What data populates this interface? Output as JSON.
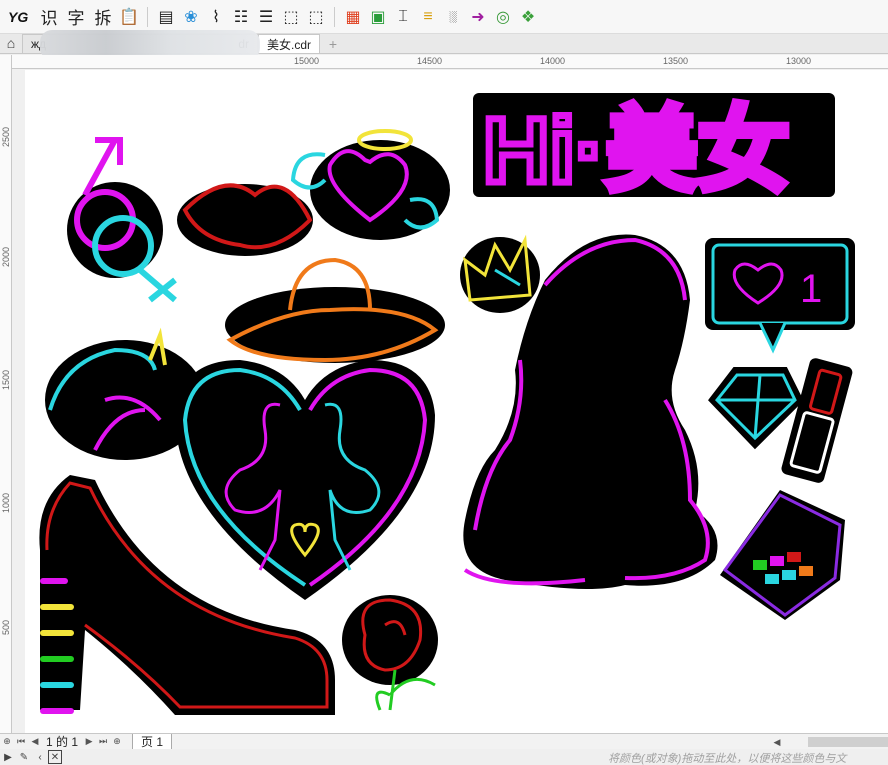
{
  "toolbar": {
    "logo": "YG",
    "zh_buttons": [
      "识",
      "字",
      "拆"
    ]
  },
  "tabs": {
    "first": "жд",
    "first_suffix": "dr",
    "active": "美女.cdr",
    "add": "+"
  },
  "ruler": {
    "top_labels": [
      "15000",
      "14500",
      "14000",
      "13500",
      "13000"
    ],
    "left_labels": [
      "2500",
      "2000",
      "1500",
      "1000",
      "500"
    ]
  },
  "artwork": {
    "headline": "Hi·美女",
    "like_count": "1"
  },
  "pagebar": {
    "page_status": "1 的 1",
    "page_tab": "页 1"
  },
  "status": {
    "hint": "将颜色(或对象)拖动至此处，以便将这些颜色与文"
  },
  "colors": {
    "neon_magenta": "#e014ef",
    "neon_cyan": "#2ad6e0",
    "neon_red": "#d11818",
    "neon_yellow": "#f2e43a",
    "neon_orange": "#f07a1a",
    "neon_green": "#22cc22"
  }
}
